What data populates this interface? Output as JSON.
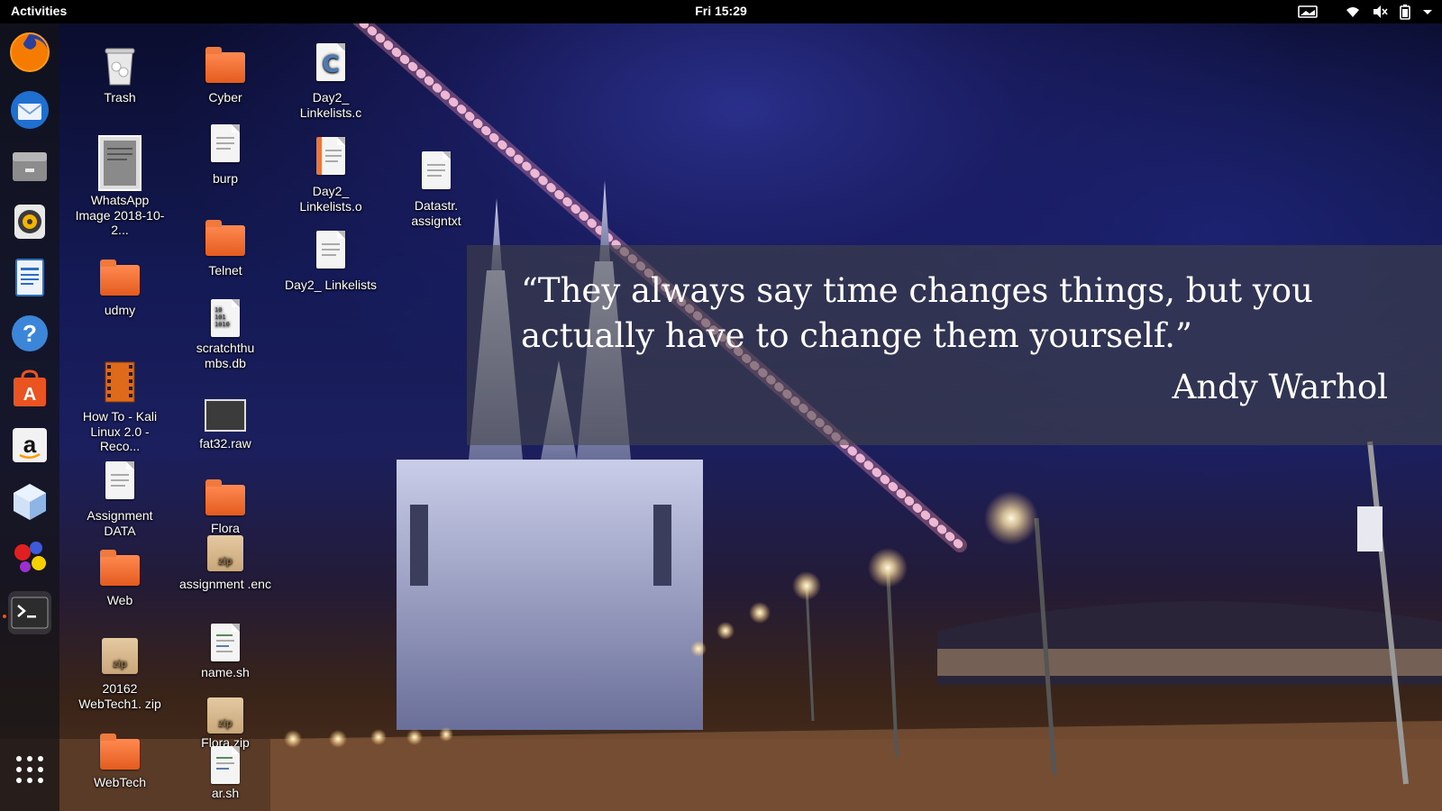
{
  "topbar": {
    "activities": "Activities",
    "clock": "Fri 15:29",
    "tray_icons": [
      "screen-icon",
      "wifi-icon",
      "volume-muted-icon",
      "battery-icon",
      "menu-arrow-icon"
    ]
  },
  "dock": {
    "apps": [
      {
        "name": "firefox-icon",
        "color": "#e66000"
      },
      {
        "name": "thunderbird-icon",
        "color": "#1f6fd0"
      },
      {
        "name": "files-icon",
        "color": "#8b8b8b"
      },
      {
        "name": "rhythmbox-icon",
        "color": "#f5b400"
      },
      {
        "name": "libreoffice-writer-icon",
        "color": "#2a6fbe"
      },
      {
        "name": "help-icon",
        "color": "#3b86d8"
      },
      {
        "name": "software-center-icon",
        "color": "#e95420"
      },
      {
        "name": "amazon-icon",
        "color": "#ffffff"
      },
      {
        "name": "virtualbox-icon",
        "color": "#a9c8f0"
      },
      {
        "name": "circles-app-icon",
        "color": "#e02020"
      },
      {
        "name": "terminal-icon",
        "color": "#2c2c2c"
      }
    ],
    "show_apps_label": "show-apps-icon"
  },
  "desktop": {
    "icons": [
      {
        "label": "Trash",
        "type": "trash"
      },
      {
        "label": "WhatsApp Image 2018-10-2...",
        "type": "image"
      },
      {
        "label": "udmy",
        "type": "folder"
      },
      {
        "label": "How To - Kali Linux 2.0 - Reco...",
        "type": "video"
      },
      {
        "label": "Assignment DATA",
        "type": "doc"
      },
      {
        "label": "Web",
        "type": "folder"
      },
      {
        "label": "20162 WebTech1. zip",
        "type": "zip"
      },
      {
        "label": "WebTech",
        "type": "folder"
      },
      {
        "label": "Cyber",
        "type": "folder"
      },
      {
        "label": "burp",
        "type": "doc"
      },
      {
        "label": "Telnet",
        "type": "folder"
      },
      {
        "label": "scratchthu mbs.db",
        "type": "db"
      },
      {
        "label": "fat32.raw",
        "type": "raw"
      },
      {
        "label": "Flora",
        "type": "folder"
      },
      {
        "label": "assignment .enc",
        "type": "zip"
      },
      {
        "label": "name.sh",
        "type": "script"
      },
      {
        "label": "Flora.zip",
        "type": "zip"
      },
      {
        "label": "ar.sh",
        "type": "script"
      },
      {
        "label": "Day2_ Linkelists.c",
        "type": "csource"
      },
      {
        "label": "Day2_ Linkelists.o",
        "type": "object"
      },
      {
        "label": "Day2_ Linkelists",
        "type": "doc"
      },
      {
        "label": "Datastr. assigntxt",
        "type": "doc"
      }
    ]
  },
  "wallpaper": {
    "quote": "“They always say time changes things, but you actually have to change them yourself.”",
    "author": "Andy Warhol"
  }
}
